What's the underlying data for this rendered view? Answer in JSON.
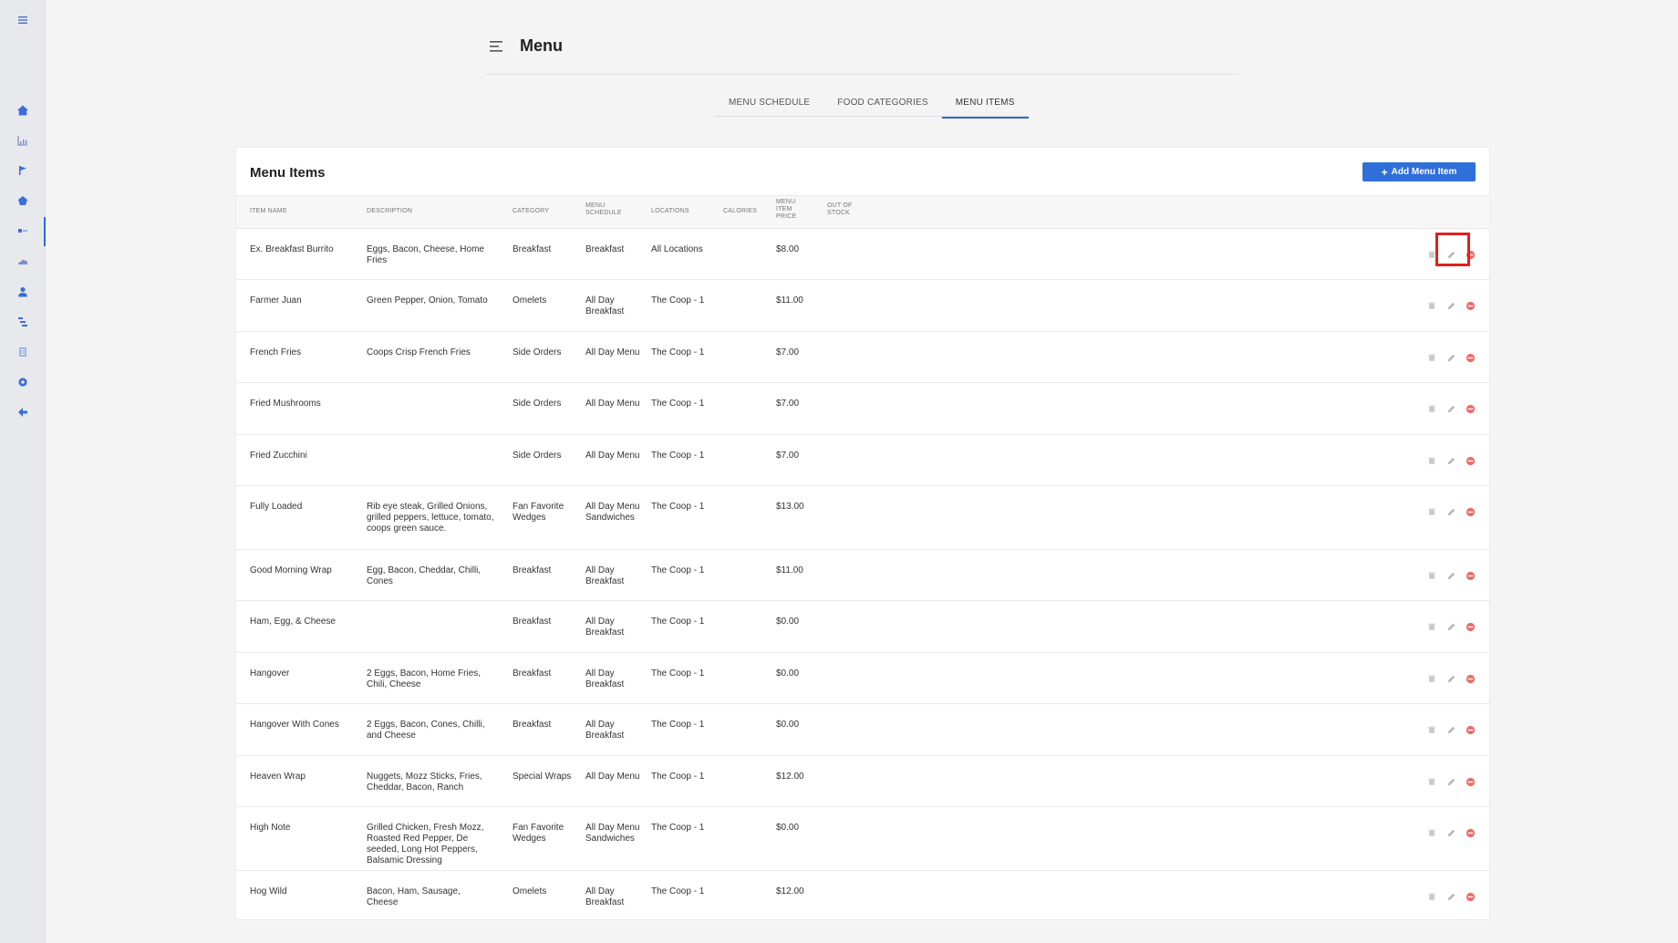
{
  "header": {
    "title": "Menu"
  },
  "tabs": [
    {
      "label": "MENU SCHEDULE"
    },
    {
      "label": "FOOD CATEGORIES"
    },
    {
      "label": "MENU ITEMS"
    }
  ],
  "active_tab": "MENU ITEMS",
  "card": {
    "title": "Menu Items",
    "add_button": "Add Menu Item"
  },
  "columns": {
    "name": "ITEM NAME",
    "description": "DESCRIPTION",
    "category": "CATEGORY",
    "schedule_1": "MENU",
    "schedule_2": "SCHEDULE",
    "locations": "LOCATIONS",
    "calories": "CALORIES",
    "price_1": "MENU",
    "price_2": "ITEM",
    "price_3": "PRICE",
    "out_1": "OUT OF",
    "out_2": "STOCK"
  },
  "rows": [
    {
      "name": "Ex. Breakfast Burrito",
      "description": "Eggs, Bacon, Cheese, Home Fries",
      "category": "Breakfast",
      "schedule": "Breakfast",
      "locations": "All Locations",
      "price": "$8.00"
    },
    {
      "name": "Farmer Juan",
      "description": "Green Pepper, Onion, Tomato",
      "category": "Omelets",
      "schedule": "All Day Breakfast",
      "locations": "The Coop - 1",
      "price": "$11.00"
    },
    {
      "name": "French Fries",
      "description": "Coops Crisp French Fries",
      "category": "Side Orders",
      "schedule": "All Day Menu",
      "locations": "The Coop - 1",
      "price": "$7.00"
    },
    {
      "name": "Fried Mushrooms",
      "description": "",
      "category": "Side Orders",
      "schedule": "All Day Menu",
      "locations": "The Coop - 1",
      "price": "$7.00"
    },
    {
      "name": "Fried Zucchini",
      "description": "",
      "category": "Side Orders",
      "schedule": "All Day Menu",
      "locations": "The Coop - 1",
      "price": "$7.00"
    },
    {
      "name": "Fully Loaded",
      "description": "Rib eye steak, Grilled Onions, grilled peppers, lettuce, tomato, coops green sauce.",
      "category": "Fan Favorite Wedges",
      "schedule": "All Day Menu Sandwiches",
      "locations": "The Coop - 1",
      "price": "$13.00"
    },
    {
      "name": "Good Morning Wrap",
      "description": "Egg, Bacon, Cheddar, Chilli, Cones",
      "category": "Breakfast",
      "schedule": "All Day Breakfast",
      "locations": "The Coop - 1",
      "price": "$11.00"
    },
    {
      "name": "Ham, Egg, & Cheese",
      "description": "",
      "category": "Breakfast",
      "schedule": "All Day Breakfast",
      "locations": "The Coop - 1",
      "price": "$0.00"
    },
    {
      "name": "Hangover",
      "description": "2 Eggs, Bacon, Home Fries, Chili, Cheese",
      "category": "Breakfast",
      "schedule": "All Day Breakfast",
      "locations": "The Coop - 1",
      "price": "$0.00"
    },
    {
      "name": "Hangover With Cones",
      "description": "2 Eggs, Bacon, Cones, Chilli, and Cheese",
      "category": "Breakfast",
      "schedule": "All Day Breakfast",
      "locations": "The Coop - 1",
      "price": "$0.00"
    },
    {
      "name": "Heaven Wrap",
      "description": "Nuggets, Mozz Sticks, Fries, Cheddar, Bacon, Ranch",
      "category": "Special Wraps",
      "schedule": "All Day Menu",
      "locations": "The Coop - 1",
      "price": "$12.00"
    },
    {
      "name": "High Note",
      "description": "Grilled Chicken, Fresh Mozz, Roasted Red Pepper, De seeded, Long Hot Peppers, Balsamic Dressing",
      "category": "Fan Favorite Wedges",
      "schedule": "All Day Menu Sandwiches",
      "locations": "The Coop - 1",
      "price": "$0.00"
    },
    {
      "name": "Hog Wild",
      "description": "Bacon, Ham, Sausage, Cheese",
      "category": "Omelets",
      "schedule": "All Day Breakfast",
      "locations": "The Coop - 1",
      "price": "$12.00"
    }
  ],
  "sidebar": {
    "icons": [
      "menu-icon",
      "home-icon",
      "chart-icon",
      "flag-icon",
      "tag-icon",
      "toggle-icon",
      "cloud-icon",
      "user-icon",
      "list-icon",
      "document-icon",
      "gear-icon",
      "back-arrow-icon"
    ]
  },
  "colors": {
    "accent": "#2f6fd9",
    "delete": "#e85a5a",
    "highlight": "#e02020"
  }
}
